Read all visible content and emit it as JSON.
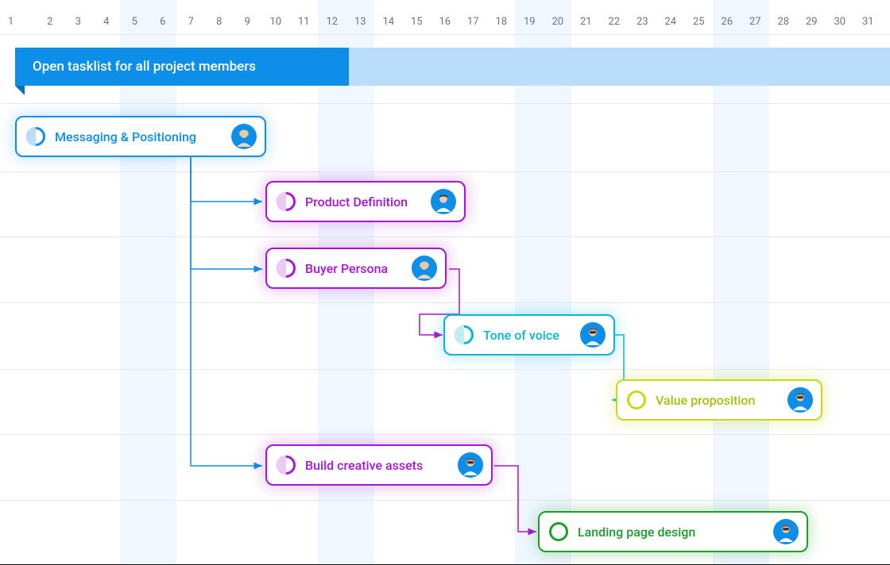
{
  "days": [
    "1",
    "2",
    "3",
    "4",
    "5",
    "6",
    "7",
    "8",
    "9",
    "10",
    "11",
    "12",
    "13",
    "14",
    "15",
    "16",
    "17",
    "18",
    "19",
    "20",
    "21",
    "22",
    "23",
    "24",
    "25",
    "26",
    "27",
    "28",
    "29",
    "30",
    "31"
  ],
  "ribbon": {
    "title": "Open tasklist for all project members"
  },
  "tasks": {
    "t1": {
      "label": "Messaging & Positioning"
    },
    "t2": {
      "label": "Product Definition"
    },
    "t3": {
      "label": "Buyer Persona"
    },
    "t4": {
      "label": "Tone of voice"
    },
    "t5": {
      "label": "Value proposition"
    },
    "t6": {
      "label": "Build creative assets"
    },
    "t7": {
      "label": "Landing  page design"
    }
  },
  "colors": {
    "blue": "#0d8ee8",
    "purple": "#a815d3",
    "cyan": "#06b6d4",
    "lime": "#c4db16",
    "green": "#1f9c2c"
  },
  "chart_data": {
    "type": "gantt",
    "title": "Open tasklist for all project members",
    "x_range": [
      1,
      31
    ],
    "weekend_columns": [
      [
        5,
        6
      ],
      [
        12,
        13
      ],
      [
        19,
        20
      ],
      [
        26,
        27
      ]
    ],
    "tasks": [
      {
        "id": "t1",
        "name": "Messaging & Positioning",
        "start": 1,
        "end": 9,
        "row": 1,
        "color": "blue",
        "progress": 0.5,
        "assignee": "female-1",
        "depends_on": []
      },
      {
        "id": "t2",
        "name": "Product Definition",
        "start": 10,
        "end": 16,
        "row": 2,
        "color": "purple",
        "progress": 0.5,
        "assignee": "male-1",
        "depends_on": [
          "t1"
        ]
      },
      {
        "id": "t3",
        "name": "Buyer Persona",
        "start": 10,
        "end": 15,
        "row": 3,
        "color": "purple",
        "progress": 0.5,
        "assignee": "female-1",
        "depends_on": [
          "t1"
        ]
      },
      {
        "id": "t4",
        "name": "Tone of voice",
        "start": 16,
        "end": 21,
        "row": 4,
        "color": "cyan",
        "progress": 0.5,
        "assignee": "male-2",
        "depends_on": [
          "t3"
        ]
      },
      {
        "id": "t5",
        "name": "Value proposition",
        "start": 22,
        "end": 29,
        "row": 5,
        "color": "lime",
        "progress": 0,
        "assignee": "male-2",
        "depends_on": [
          "t4"
        ]
      },
      {
        "id": "t6",
        "name": "Build creative assets",
        "start": 10,
        "end": 18,
        "row": 6,
        "color": "purple",
        "progress": 0.5,
        "assignee": "male-2",
        "depends_on": [
          "t1"
        ]
      },
      {
        "id": "t7",
        "name": "Landing  page design",
        "start": 19,
        "end": 29,
        "row": 7,
        "color": "green",
        "progress": 0,
        "assignee": "male-2",
        "depends_on": [
          "t6"
        ]
      }
    ]
  }
}
